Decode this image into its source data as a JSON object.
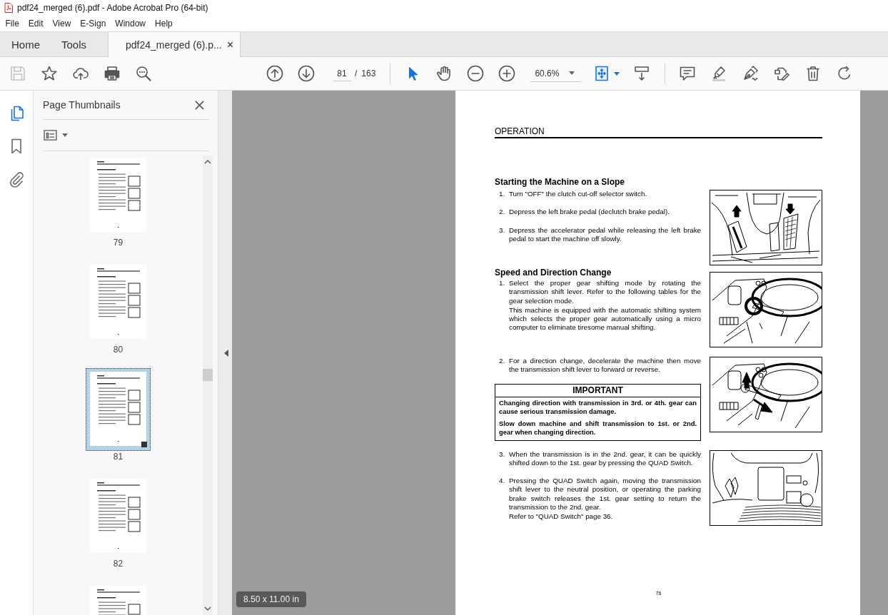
{
  "window": {
    "title": "pdf24_merged (6).pdf - Adobe Acrobat Pro (64-bit)"
  },
  "menu": [
    "File",
    "Edit",
    "View",
    "E-Sign",
    "Window",
    "Help"
  ],
  "tabs": [
    {
      "label": "Home",
      "selected": false,
      "closable": false
    },
    {
      "label": "Tools",
      "selected": false,
      "closable": false
    },
    {
      "label": "pdf24_merged (6).p...",
      "selected": true,
      "closable": true
    }
  ],
  "toolbar": {
    "save": {
      "disabled": true
    },
    "page": {
      "current": "81",
      "separator": "/",
      "total": "163"
    },
    "tools": [
      {
        "kind": "select",
        "selected": true
      },
      {
        "kind": "hand",
        "selected": false
      }
    ],
    "zoom": "60.6%"
  },
  "rail": [
    {
      "kind": "pages",
      "selected": true
    },
    {
      "kind": "bookmarks",
      "selected": false
    },
    {
      "kind": "attachments",
      "selected": false
    }
  ],
  "panel": {
    "title": "Page Thumbnails",
    "thumbnails": [
      {
        "label": "79",
        "selected": false
      },
      {
        "label": "80",
        "selected": false
      },
      {
        "label": "81",
        "selected": true
      },
      {
        "label": "82",
        "selected": false
      },
      {
        "selected": false
      }
    ]
  },
  "document": {
    "header": "OPERATION",
    "rows": [
      {
        "heading": "Starting the Machine on a Slope"
      },
      {
        "steps": [
          {
            "number": "1.",
            "paragraphs": [
              "Turn \"OFF\" the clutch cut-off selector switch."
            ]
          },
          {
            "number": "2.",
            "paragraphs": [
              "Depress the left brake pedal (declutch brake pedal)."
            ]
          },
          {
            "number": "3.",
            "paragraphs": [
              "Depress the accelerator pedal while releasing the left brake pedal to start the machine off slowly."
            ]
          }
        ],
        "figure": {
          "kind": "pedals"
        }
      },
      {
        "heading": "Speed and Direction Change",
        "steps": [
          {
            "number": "1.",
            "paragraphs": [
              "Select the proper gear shifting mode by rotating the transmission shift lever. Refer to the following tables for the gear selection mode.",
              "This machine is equipped with the automatic shifting system which selects the proper gear automatically using a micro computer to eliminate tiresome manual shifting."
            ]
          }
        ],
        "figure": {
          "kind": "steering_wheel"
        }
      },
      {
        "steps": [
          {
            "number": "2.",
            "paragraphs": [
              "For a direction change, decelerate the machine then move the transmission shift lever to forward or reverse."
            ]
          }
        ],
        "notice": {
          "title": "IMPORTANT",
          "paragraphs": [
            "Changing direction with transmission in 3rd. or 4th. gear can cause serious transmission damage.",
            "Slow down machine and shift transmission to 1st. or 2nd. gear when changing direction."
          ]
        },
        "figure": {
          "kind": "shift_lever"
        }
      },
      {
        "steps": [
          {
            "number": "3.",
            "paragraphs": [
              "When the transmission is in the 2nd. gear, it can be quickly shifted down to the 1st. gear by pressing the QUAD Switch."
            ]
          },
          {
            "number": "4.",
            "paragraphs": [
              "Pressing the QUAD Switch again, moving the transmission shift lever to the neutral position, or operating the parking brake switch releases the 1st. gear setting to return the transmission to the 2nd. gear.",
              "Refer to \"QUAD Switch\" page 36."
            ]
          }
        ],
        "figure": {
          "kind": "console"
        }
      }
    ],
    "page_number": "76"
  },
  "page_size": "8.50 x 11.00 in"
}
